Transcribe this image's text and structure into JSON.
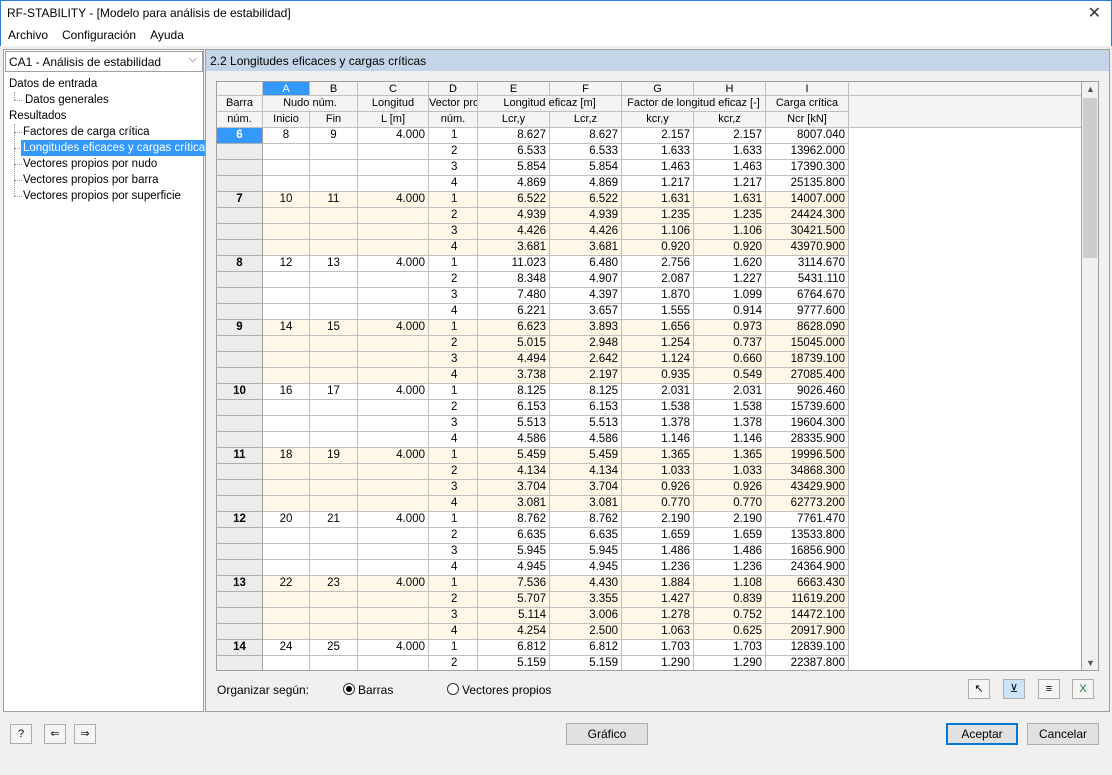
{
  "window": {
    "title": "RF-STABILITY - [Modelo para análisis de estabilidad]"
  },
  "menu": [
    "Archivo",
    "Configuración",
    "Ayuda"
  ],
  "case_select": "CA1 - Análisis de estabilidad",
  "tree": {
    "input_label": "Datos de entrada",
    "input_items": [
      "Datos generales"
    ],
    "results_label": "Resultados",
    "result_items": [
      "Factores de carga crítica",
      "Longitudes eficaces y cargas críticas",
      "Vectores propios por nudo",
      "Vectores propios por barra",
      "Vectores propios por superficie"
    ],
    "selected_index": 1
  },
  "panel_title": "2.2 Longitudes eficaces y cargas críticas",
  "columns": {
    "letters": [
      "A",
      "B",
      "C",
      "D",
      "E",
      "F",
      "G",
      "H",
      "I"
    ],
    "row_header": [
      "Barra",
      "núm."
    ],
    "node_group": "Nudo núm.",
    "node_start": "Inicio",
    "node_end": "Fin",
    "length_1": "Longitud",
    "length_2": "L [m]",
    "vector_1": "Vector pro",
    "vector_2": "núm.",
    "eff_group": "Longitud eficaz [m]",
    "lcr_y": "Lcr,y",
    "lcr_z": "Lcr,z",
    "k_group": "Factor de longitud eficaz [-]",
    "kcr_y": "kcr,y",
    "kcr_z": "kcr,z",
    "ncr_1": "Carga crítica",
    "ncr_2": "Ncr [kN]"
  },
  "members": [
    {
      "id": "6",
      "start": "8",
      "end": "9",
      "length": "4.000",
      "rows": [
        [
          "1",
          "8.627",
          "8.627",
          "2.157",
          "2.157",
          "8007.040"
        ],
        [
          "2",
          "6.533",
          "6.533",
          "1.633",
          "1.633",
          "13962.000"
        ],
        [
          "3",
          "5.854",
          "5.854",
          "1.463",
          "1.463",
          "17390.300"
        ],
        [
          "4",
          "4.869",
          "4.869",
          "1.217",
          "1.217",
          "25135.800"
        ]
      ]
    },
    {
      "id": "7",
      "start": "10",
      "end": "11",
      "length": "4.000",
      "rows": [
        [
          "1",
          "6.522",
          "6.522",
          "1.631",
          "1.631",
          "14007.000"
        ],
        [
          "2",
          "4.939",
          "4.939",
          "1.235",
          "1.235",
          "24424.300"
        ],
        [
          "3",
          "4.426",
          "4.426",
          "1.106",
          "1.106",
          "30421.500"
        ],
        [
          "4",
          "3.681",
          "3.681",
          "0.920",
          "0.920",
          "43970.900"
        ]
      ]
    },
    {
      "id": "8",
      "start": "12",
      "end": "13",
      "length": "4.000",
      "rows": [
        [
          "1",
          "11.023",
          "6.480",
          "2.756",
          "1.620",
          "3114.670"
        ],
        [
          "2",
          "8.348",
          "4.907",
          "2.087",
          "1.227",
          "5431.110"
        ],
        [
          "3",
          "7.480",
          "4.397",
          "1.870",
          "1.099",
          "6764.670"
        ],
        [
          "4",
          "6.221",
          "3.657",
          "1.555",
          "0.914",
          "9777.600"
        ]
      ]
    },
    {
      "id": "9",
      "start": "14",
      "end": "15",
      "length": "4.000",
      "rows": [
        [
          "1",
          "6.623",
          "3.893",
          "1.656",
          "0.973",
          "8628.090"
        ],
        [
          "2",
          "5.015",
          "2.948",
          "1.254",
          "0.737",
          "15045.000"
        ],
        [
          "3",
          "4.494",
          "2.642",
          "1.124",
          "0.660",
          "18739.100"
        ],
        [
          "4",
          "3.738",
          "2.197",
          "0.935",
          "0.549",
          "27085.400"
        ]
      ]
    },
    {
      "id": "10",
      "start": "16",
      "end": "17",
      "length": "4.000",
      "rows": [
        [
          "1",
          "8.125",
          "8.125",
          "2.031",
          "2.031",
          "9026.460"
        ],
        [
          "2",
          "6.153",
          "6.153",
          "1.538",
          "1.538",
          "15739.600"
        ],
        [
          "3",
          "5.513",
          "5.513",
          "1.378",
          "1.378",
          "19604.300"
        ],
        [
          "4",
          "4.586",
          "4.586",
          "1.146",
          "1.146",
          "28335.900"
        ]
      ]
    },
    {
      "id": "11",
      "start": "18",
      "end": "19",
      "length": "4.000",
      "rows": [
        [
          "1",
          "5.459",
          "5.459",
          "1.365",
          "1.365",
          "19996.500"
        ],
        [
          "2",
          "4.134",
          "4.134",
          "1.033",
          "1.033",
          "34868.300"
        ],
        [
          "3",
          "3.704",
          "3.704",
          "0.926",
          "0.926",
          "43429.900"
        ],
        [
          "4",
          "3.081",
          "3.081",
          "0.770",
          "0.770",
          "62773.200"
        ]
      ]
    },
    {
      "id": "12",
      "start": "20",
      "end": "21",
      "length": "4.000",
      "rows": [
        [
          "1",
          "8.762",
          "8.762",
          "2.190",
          "2.190",
          "7761.470"
        ],
        [
          "2",
          "6.635",
          "6.635",
          "1.659",
          "1.659",
          "13533.800"
        ],
        [
          "3",
          "5.945",
          "5.945",
          "1.486",
          "1.486",
          "16856.900"
        ],
        [
          "4",
          "4.945",
          "4.945",
          "1.236",
          "1.236",
          "24364.900"
        ]
      ]
    },
    {
      "id": "13",
      "start": "22",
      "end": "23",
      "length": "4.000",
      "rows": [
        [
          "1",
          "7.536",
          "4.430",
          "1.884",
          "1.108",
          "6663.430"
        ],
        [
          "2",
          "5.707",
          "3.355",
          "1.427",
          "0.839",
          "11619.200"
        ],
        [
          "3",
          "5.114",
          "3.006",
          "1.278",
          "0.752",
          "14472.100"
        ],
        [
          "4",
          "4.254",
          "2.500",
          "1.063",
          "0.625",
          "20917.900"
        ]
      ]
    },
    {
      "id": "14",
      "start": "24",
      "end": "25",
      "length": "4.000",
      "rows": [
        [
          "1",
          "6.812",
          "6.812",
          "1.703",
          "1.703",
          "12839.100"
        ],
        [
          "2",
          "5.159",
          "5.159",
          "1.290",
          "1.290",
          "22387.800"
        ]
      ]
    }
  ],
  "sort": {
    "label": "Organizar según:",
    "option_members": "Barras",
    "option_vectors": "Vectores propios",
    "selected": "members"
  },
  "buttons": {
    "graphic": "Gráfico",
    "accept": "Aceptar",
    "cancel": "Cancelar"
  },
  "colors": {
    "selection": "#3399ff",
    "header_band": "#c5d5e8",
    "alt_row": "#fff8e8"
  }
}
